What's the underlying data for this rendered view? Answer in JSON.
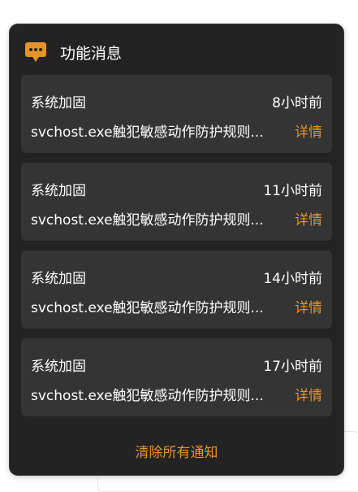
{
  "panel": {
    "title": "功能消息",
    "icon": "chat-bubble-icon",
    "accent_color": "#e8922a",
    "background_color": "#232323",
    "item_background_color": "#343434"
  },
  "notifications": [
    {
      "category": "系统加固",
      "time": "8小时前",
      "message": "svchost.exe触犯敏感动作防护规则...",
      "detail_label": "详情"
    },
    {
      "category": "系统加固",
      "time": "11小时前",
      "message": "svchost.exe触犯敏感动作防护规则...",
      "detail_label": "详情"
    },
    {
      "category": "系统加固",
      "time": "14小时前",
      "message": "svchost.exe触犯敏感动作防护规则...",
      "detail_label": "详情"
    },
    {
      "category": "系统加固",
      "time": "17小时前",
      "message": "svchost.exe触犯敏感动作防护规则...",
      "detail_label": "详情"
    }
  ],
  "footer": {
    "clear_all_label": "清除所有通知"
  }
}
